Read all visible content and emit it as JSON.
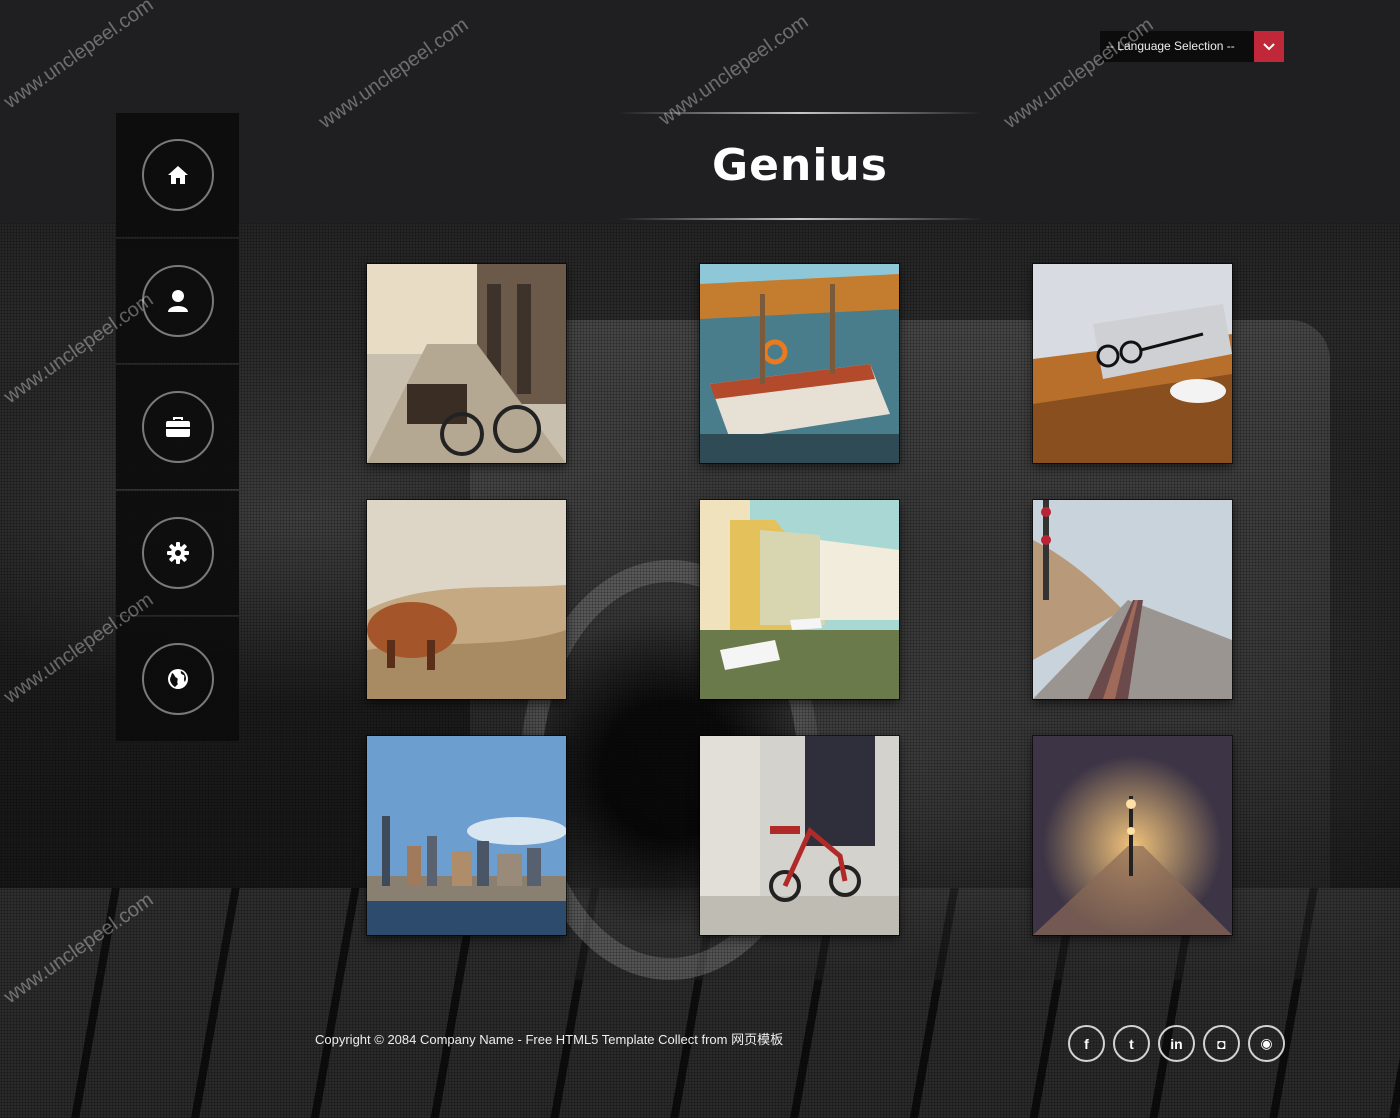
{
  "header": {
    "language_select": {
      "value": "-- Language Selection --"
    },
    "site_title": "Genius"
  },
  "nav": {
    "items": [
      {
        "id": "home",
        "icon": "home-icon"
      },
      {
        "id": "user",
        "icon": "user-icon"
      },
      {
        "id": "portfolio",
        "icon": "briefcase-icon"
      },
      {
        "id": "settings",
        "icon": "gear-icon"
      },
      {
        "id": "globe",
        "icon": "globe-icon"
      }
    ]
  },
  "gallery": {
    "items": [
      {
        "subject": "street-bicycles-photo"
      },
      {
        "subject": "sailboat-harbor-photo"
      },
      {
        "subject": "desk-glasses-mouse-photo"
      },
      {
        "subject": "highland-cow-photo"
      },
      {
        "subject": "canal-houses-photo"
      },
      {
        "subject": "coastal-railway-photo"
      },
      {
        "subject": "city-skyline-photo"
      },
      {
        "subject": "tricycle-doorway-photo"
      },
      {
        "subject": "foggy-night-road-photo"
      }
    ]
  },
  "footer": {
    "copyright": "Copyright © 2084 Company Name - Free HTML5 Template Collect from 网页模板",
    "social": [
      {
        "icon": "facebook-icon",
        "glyph": "f"
      },
      {
        "icon": "twitter-icon",
        "glyph": "t"
      },
      {
        "icon": "linkedin-icon",
        "glyph": "in"
      },
      {
        "icon": "instagram-icon",
        "glyph": "◘"
      },
      {
        "icon": "rss-icon",
        "glyph": "◉"
      }
    ]
  },
  "watermark": "www.unclepeel.com",
  "colors": {
    "accent": "#c0283a",
    "header_bg": "#1f1f21",
    "nav_bg": "#0c0c0c"
  }
}
